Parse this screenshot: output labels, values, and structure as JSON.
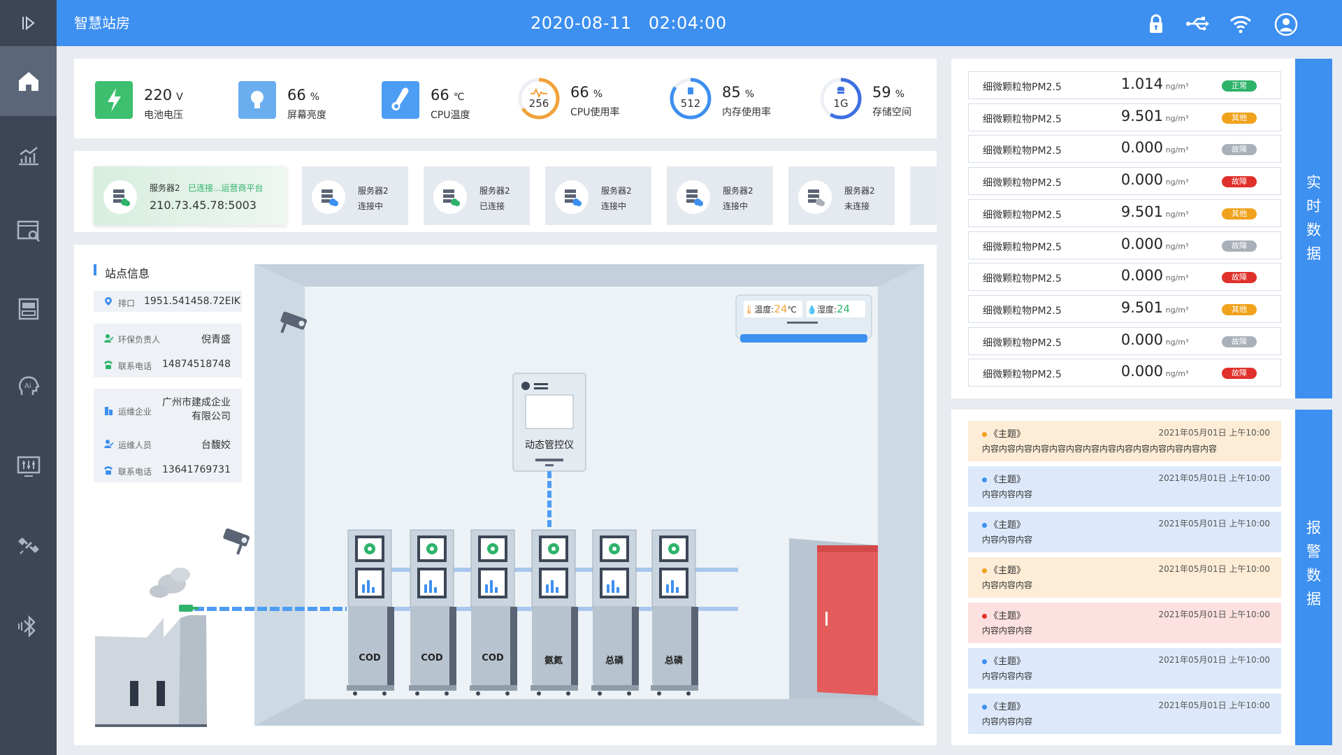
{
  "header": {
    "title": "智慧站房",
    "datetime": "2020-08-11   02:04:00"
  },
  "sidebar": {
    "items": [
      "home-icon",
      "chart-icon",
      "monitor-search-icon",
      "cabinet-icon",
      "ai-head-icon",
      "monitor-settings-icon",
      "satellite-icon",
      "bluetooth-icon"
    ]
  },
  "stats": [
    {
      "value": "220",
      "unit": "V",
      "label": "电池电压",
      "icon": "lightning-icon",
      "color": "#3cbf6e"
    },
    {
      "value": "66",
      "unit": "%",
      "label": "屏幕亮度",
      "icon": "bulb-icon",
      "color": "#6aaef0"
    },
    {
      "value": "66",
      "unit": "℃",
      "label": "CPU温度",
      "icon": "thermometer-icon",
      "color": "#4d9df5"
    },
    {
      "value": "66",
      "unit": "%",
      "label": "CPU使用率",
      "ring": "256",
      "ring_fraction": 0.66,
      "color": "#f2a23a"
    },
    {
      "value": "85",
      "unit": "%",
      "label": "内存使用率",
      "ring": "512",
      "ring_fraction": 0.85,
      "color": "#3d8ff0"
    },
    {
      "value": "59",
      "unit": "%",
      "label": "存储空间",
      "ring": "1G",
      "ring_fraction": 0.59,
      "color": "#3d6fe0"
    }
  ],
  "servers": [
    {
      "name": "服务器2",
      "status_inline": "已连接...运营商平台",
      "address": "210.73.45.78:5003",
      "active": true
    },
    {
      "name": "服务器2",
      "status": "连接中"
    },
    {
      "name": "服务器2",
      "status": "已连接"
    },
    {
      "name": "服务器2",
      "status": "连接中"
    },
    {
      "name": "服务器2",
      "status": "连接中"
    },
    {
      "name": "服务器2",
      "status": "未连接"
    }
  ],
  "station": {
    "title": "站点信息",
    "outlet_label": "排口",
    "outlet": "1951.541458.72EIK",
    "env_label": "环保负责人",
    "env_person": "倪青盛",
    "phone_label": "联系电话",
    "env_phone": "14874518748",
    "company_label": "运维企业",
    "company": "广州市建成企业有限公司",
    "op_label": "运维人员",
    "op_person": "台馥姣",
    "op_phone": "13641769731"
  },
  "room": {
    "controller_label": "动态管控仪",
    "ac_temp_label": "温度:",
    "ac_temp": "24",
    "ac_temp_unit": "℃",
    "ac_hum_label": "湿度:",
    "ac_hum": "24",
    "cabinets": [
      "COD",
      "COD",
      "COD",
      "氨氮",
      "总磷",
      "总磷"
    ]
  },
  "realtime": {
    "tab": "实时数据",
    "rows": [
      {
        "name": "细微颗粒物PM2.5",
        "value": "1.014",
        "unit": "ng/m³",
        "badge": "正常",
        "color": "#2fb36a"
      },
      {
        "name": "细微颗粒物PM2.5",
        "value": "9.501",
        "unit": "ng/m³",
        "badge": "其他",
        "color": "#f0a21c"
      },
      {
        "name": "细微颗粒物PM2.5",
        "value": "0.000",
        "unit": "ng/m³",
        "badge": "故障",
        "color": "#a9b0b9"
      },
      {
        "name": "细微颗粒物PM2.5",
        "value": "0.000",
        "unit": "ng/m³",
        "badge": "故障",
        "color": "#e0302b"
      },
      {
        "name": "细微颗粒物PM2.5",
        "value": "9.501",
        "unit": "ng/m³",
        "badge": "其他",
        "color": "#f0a21c"
      },
      {
        "name": "细微颗粒物PM2.5",
        "value": "0.000",
        "unit": "ng/m³",
        "badge": "故障",
        "color": "#a9b0b9"
      },
      {
        "name": "细微颗粒物PM2.5",
        "value": "0.000",
        "unit": "ng/m³",
        "badge": "故障",
        "color": "#e0302b"
      },
      {
        "name": "细微颗粒物PM2.5",
        "value": "9.501",
        "unit": "ng/m³",
        "badge": "其他",
        "color": "#f0a21c"
      },
      {
        "name": "细微颗粒物PM2.5",
        "value": "0.000",
        "unit": "ng/m³",
        "badge": "故障",
        "color": "#a9b0b9"
      },
      {
        "name": "细微颗粒物PM2.5",
        "value": "0.000",
        "unit": "ng/m³",
        "badge": "故障",
        "color": "#e0302b"
      }
    ]
  },
  "alarms": {
    "tab": "报警数据",
    "items": [
      {
        "title": "《主题》",
        "date": "2021年05月01日  上午10:00",
        "content": "内容内容内容内容内容内容内容内容内容内容内容内容内容内容",
        "bg": "#fdecd6",
        "dot": "#f0a21c"
      },
      {
        "title": "《主题》",
        "date": "2021年05月01日  上午10:00",
        "content": "内容内容内容",
        "bg": "#dde9fb",
        "dot": "#3d8ff0"
      },
      {
        "title": "《主题》",
        "date": "2021年05月01日  上午10:00",
        "content": "内容内容内容",
        "bg": "#dde9fb",
        "dot": "#3d8ff0"
      },
      {
        "title": "《主题》",
        "date": "2021年05月01日  上午10:00",
        "content": "内容内容内容",
        "bg": "#fdecd6",
        "dot": "#f0a21c"
      },
      {
        "title": "《主题》",
        "date": "2021年05月01日  上午10:00",
        "content": "内容内容内容",
        "bg": "#fde0e0",
        "dot": "#e0302b"
      },
      {
        "title": "《主题》",
        "date": "2021年05月01日  上午10:00",
        "content": "内容内容内容",
        "bg": "#dde9fb",
        "dot": "#3d8ff0"
      },
      {
        "title": "《主题》",
        "date": "2021年05月01日  上午10:00",
        "content": "内容内容内容",
        "bg": "#dde9fb",
        "dot": "#3d8ff0"
      }
    ]
  }
}
